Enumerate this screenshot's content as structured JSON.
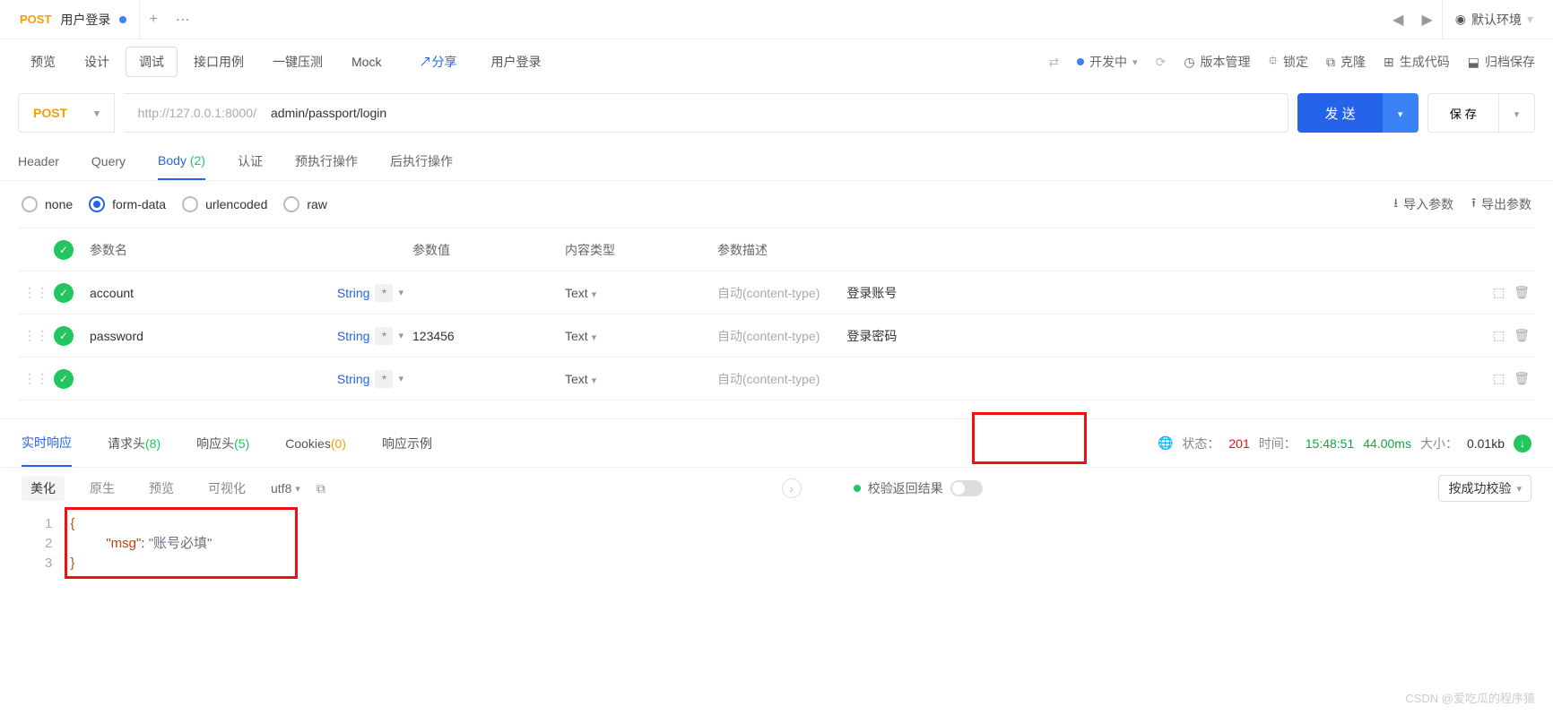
{
  "topTab": {
    "method": "POST",
    "title": "用户登录"
  },
  "env": {
    "label": "默认环境"
  },
  "modeTabs": [
    "预览",
    "设计",
    "调试",
    "接口用例",
    "一键压测",
    "Mock"
  ],
  "modeActive": "调试",
  "share": "分享",
  "breadcrumb": "用户登录",
  "devStatus": "开发中",
  "tools": {
    "version": "版本管理",
    "lock": "锁定",
    "clone": "克隆",
    "gencode": "生成代码",
    "archive": "归档保存"
  },
  "request": {
    "method": "POST",
    "base": "http://127.0.0.1:8000/",
    "path": "admin/passport/login",
    "send": "发 送",
    "save": "保 存"
  },
  "subTabs": {
    "header": "Header",
    "query": "Query",
    "body": "Body",
    "bodyCount": "(2)",
    "auth": "认证",
    "pre": "预执行操作",
    "post": "后执行操作"
  },
  "bodyTypes": {
    "none": "none",
    "form": "form-data",
    "url": "urlencoded",
    "raw": "raw"
  },
  "io": {
    "import": "导入参数",
    "export": "导出参数"
  },
  "cols": {
    "name": "参数名",
    "value": "参数值",
    "ctype": "内容类型",
    "desc": "参数描述"
  },
  "rows": [
    {
      "name": "account",
      "type": "String",
      "value": "",
      "text": "Text",
      "ctypePh": "自动(content-type)",
      "desc": "登录账号"
    },
    {
      "name": "password",
      "type": "String",
      "value": "123456",
      "text": "Text",
      "ctypePh": "自动(content-type)",
      "desc": "登录密码"
    },
    {
      "name": "",
      "type": "String",
      "value": "",
      "text": "Text",
      "ctypePh": "自动(content-type)",
      "desc": ""
    }
  ],
  "respTabs": {
    "live": "实时响应",
    "reqh": "请求头",
    "reqhCount": "(8)",
    "resph": "响应头",
    "resphCount": "(5)",
    "cookies": "Cookies",
    "cookiesCount": "(0)",
    "example": "响应示例"
  },
  "respMeta": {
    "statusLabel": "状态：",
    "status": "201",
    "timeLabel": "时间：",
    "time": "15:48:51",
    "duration": "44.00ms",
    "sizeLabel": "大小：",
    "size": "0.01kb"
  },
  "viewTabs": {
    "pretty": "美化",
    "raw": "原生",
    "preview": "预览",
    "visual": "可视化"
  },
  "encoding": "utf8",
  "verify": {
    "label": "校验返回结果",
    "btn": "按成功校验"
  },
  "code": {
    "l1": "{",
    "l2key": "\"msg\"",
    "l2val": "\"账号必填\"",
    "l3": "}"
  },
  "watermark": "CSDN @爱吃瓜的程序猿"
}
